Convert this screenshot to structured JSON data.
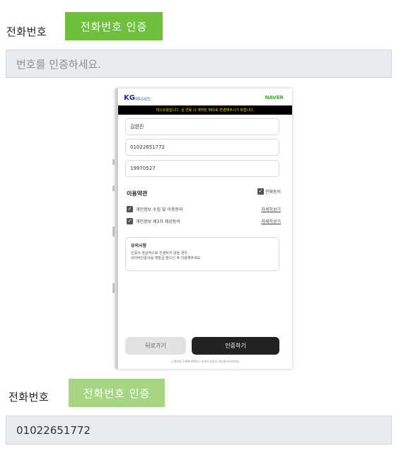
{
  "top": {
    "label": "전화번호",
    "verify_button": "전화번호 인증",
    "input_placeholder": "번호를 인증하세요."
  },
  "popup": {
    "logo": "KG",
    "logo_sub": "이니시스",
    "partner": "NAVER",
    "test_banner": "테스트용입니다. 실 연동 시 계약된 MID로 변경해주시기 바랍니다.",
    "fields": {
      "name": "김완진",
      "phone": "01022651772",
      "birth": "19970527"
    },
    "terms_title": "이용약관",
    "agree_all": "전체동의",
    "terms": [
      {
        "label": "개인정보 수집 및 이용동의",
        "view": "자세히보기"
      },
      {
        "label": "개인정보 제3자 제공동의",
        "view": "자세히보기"
      }
    ],
    "notice_title": "유의사항",
    "notice_line1": "인증이 정상적으로 진행되지 않을 경우,",
    "notice_line2": "네이버인증서를 재발급 받으신 후 이용해주세요.",
    "back_button": "뒤로가기",
    "auth_button": "인증하기",
    "footer": "고객지원 1588-4954 | 네이버 인증서 개인정보처리방침"
  },
  "bottom": {
    "label": "전화번호",
    "verify_button": "전화번호 인증",
    "input_value": "01022651772"
  },
  "colors": {
    "verify_green": "#6dbf3c",
    "verify_green_faded": "#a6d682",
    "naver_green": "#1ec800",
    "kg_blue": "#1b2d8f",
    "banner_yellow": "#ffd400"
  }
}
